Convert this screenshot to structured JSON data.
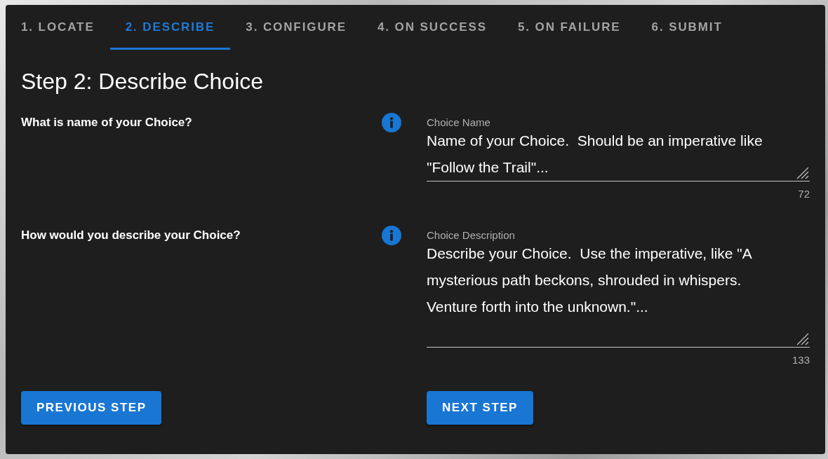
{
  "tabs": [
    {
      "label": "1. LOCATE",
      "selected": false
    },
    {
      "label": "2. DESCRIBE",
      "selected": true
    },
    {
      "label": "3. CONFIGURE",
      "selected": false
    },
    {
      "label": "4. ON SUCCESS",
      "selected": false
    },
    {
      "label": "5. ON FAILURE",
      "selected": false
    },
    {
      "label": "6. SUBMIT",
      "selected": false
    }
  ],
  "heading": "Step 2: Describe Choice",
  "questions": [
    {
      "prompt": "What is name of your Choice?",
      "field": {
        "label": "Choice Name",
        "value": "Name of your Choice.  Should be an imperative like \"Follow the Trail\"...",
        "counter": "72"
      }
    },
    {
      "prompt": "How would you describe your Choice?",
      "field": {
        "label": "Choice Description",
        "value": "Describe your Choice.  Use the imperative, like \"A mysterious path beckons, shrouded in whispers. Venture forth into the unknown.\"...",
        "counter": "133"
      }
    }
  ],
  "buttons": [
    {
      "label": "PREVIOUS STEP"
    },
    {
      "label": "NEXT STEP"
    }
  ]
}
